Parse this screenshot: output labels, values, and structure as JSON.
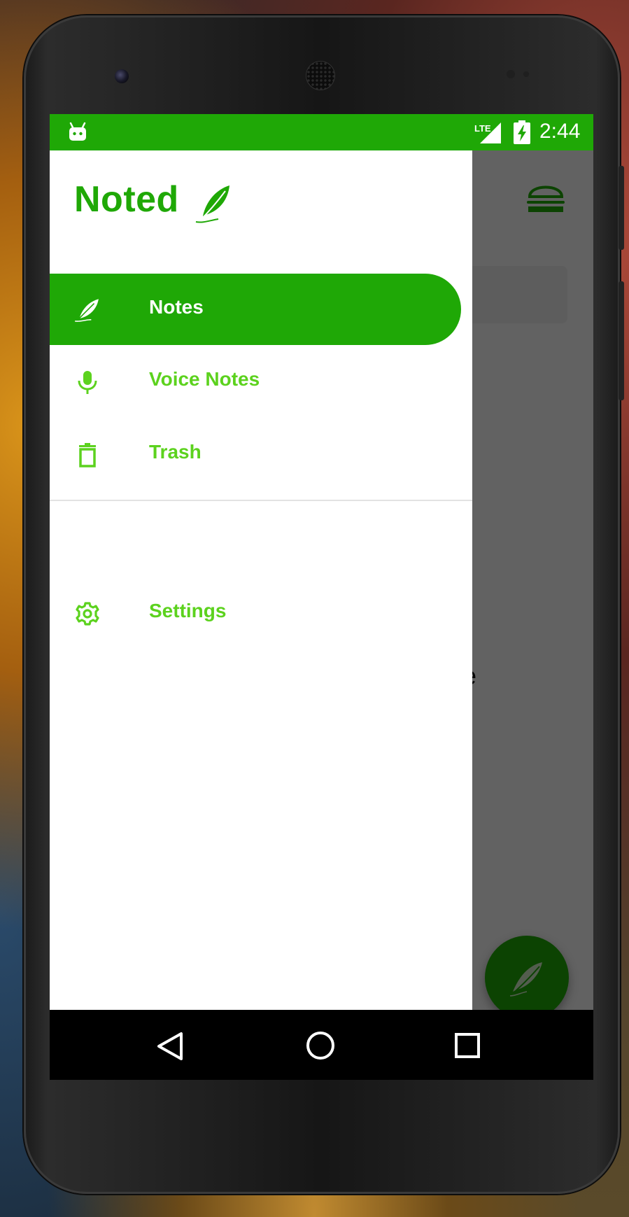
{
  "status_bar": {
    "network": "LTE",
    "time": "2:44"
  },
  "app": {
    "empty_text_partial": "ote"
  },
  "drawer": {
    "title": "Noted",
    "items": [
      {
        "label": "Notes",
        "icon": "feather-icon",
        "active": true
      },
      {
        "label": "Voice Notes",
        "icon": "microphone-icon",
        "active": false
      },
      {
        "label": "Trash",
        "icon": "trash-icon",
        "active": false
      },
      {
        "label": "Settings",
        "icon": "gear-icon",
        "active": false
      }
    ]
  },
  "nav_bar": {
    "buttons": [
      "back-icon",
      "home-icon",
      "recents-icon"
    ]
  },
  "colors": {
    "accent": "#1fa806",
    "label_green": "#5cd21e",
    "scrim": "rgba(0,0,0,0.6)"
  }
}
